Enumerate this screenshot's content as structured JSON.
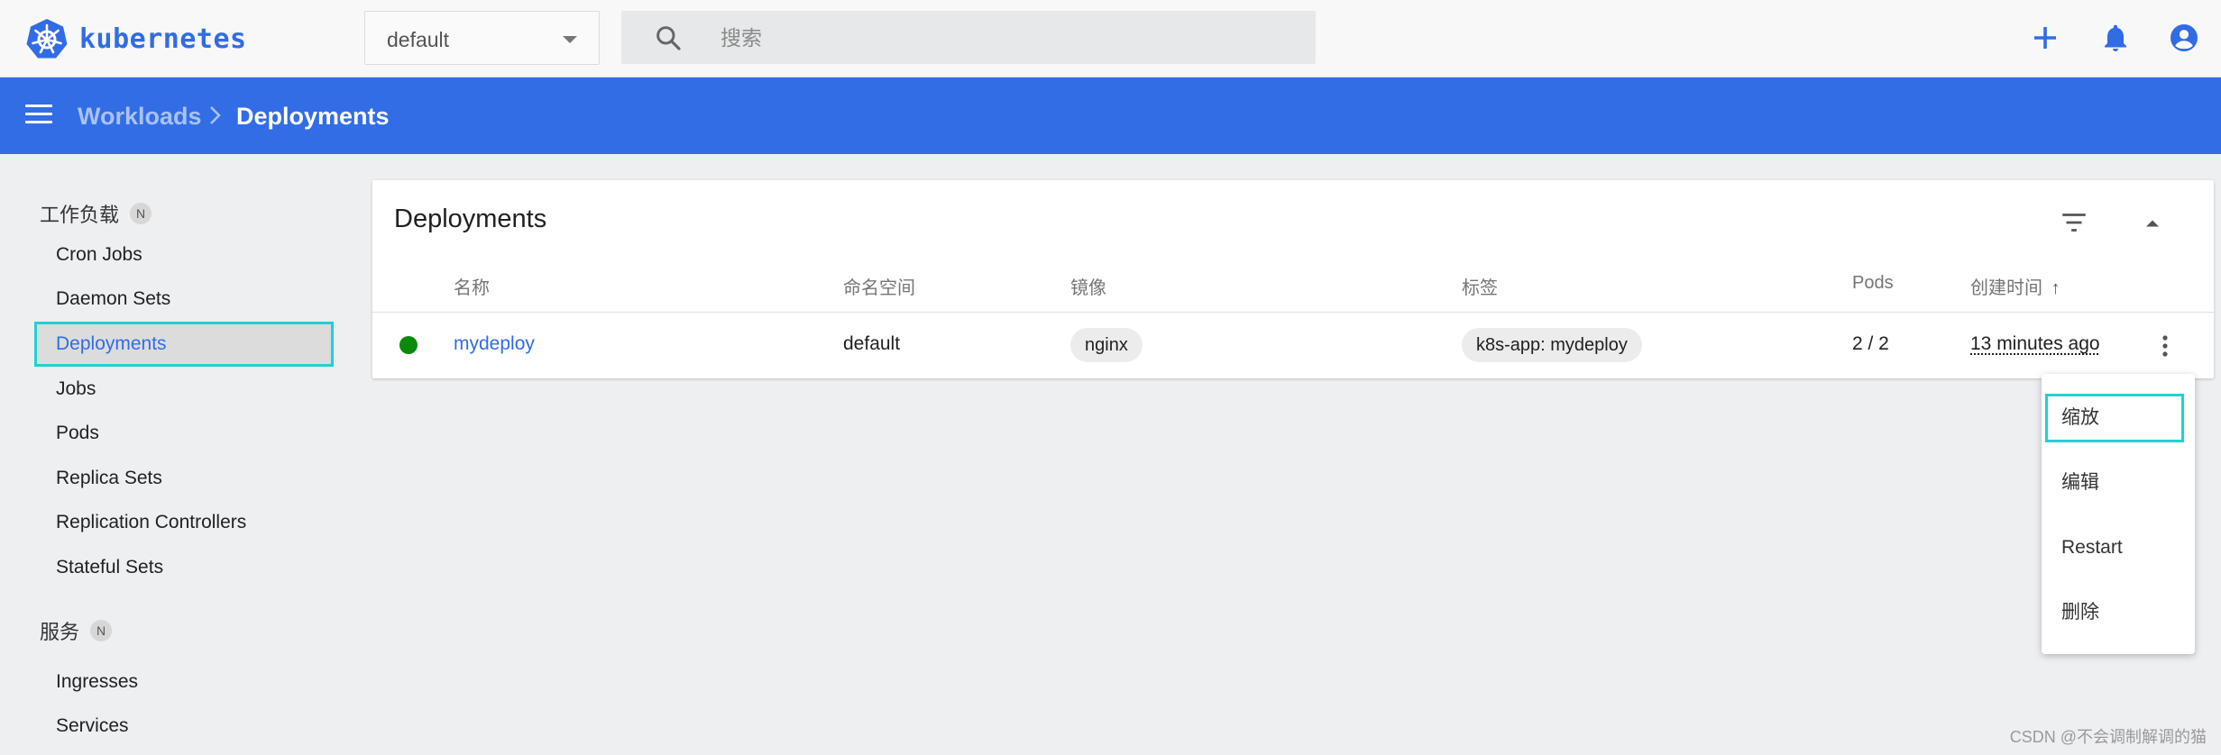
{
  "app": {
    "name": "kubernetes",
    "brand_color": "#326ce5",
    "logo_icon": "kubernetes-wheel-icon"
  },
  "topbar": {
    "namespace_value": "default",
    "search_placeholder": "搜索",
    "icons": [
      "add-icon",
      "bell-icon",
      "account-icon"
    ]
  },
  "breadcrumb": {
    "parent": "Workloads",
    "current": "Deployments"
  },
  "sidebar": {
    "sections": [
      {
        "label": "工作负载",
        "badge": "N",
        "items": [
          {
            "label": "Cron Jobs"
          },
          {
            "label": "Daemon Sets"
          },
          {
            "label": "Deployments",
            "active": true
          },
          {
            "label": "Jobs"
          },
          {
            "label": "Pods"
          },
          {
            "label": "Replica Sets"
          },
          {
            "label": "Replication Controllers"
          },
          {
            "label": "Stateful Sets"
          }
        ]
      },
      {
        "label": "服务",
        "badge": "N",
        "items": [
          {
            "label": "Ingresses"
          },
          {
            "label": "Services"
          }
        ]
      }
    ]
  },
  "card": {
    "title": "Deployments",
    "columns": [
      "名称",
      "命名空间",
      "镜像",
      "标签",
      "Pods",
      "创建时间"
    ],
    "sort_indicator": "↑",
    "rows": [
      {
        "status": "running",
        "status_color": "#0a8a0a",
        "name": "mydeploy",
        "namespace": "default",
        "image": "nginx",
        "label": "k8s-app: mydeploy",
        "pods": "2 / 2",
        "created": "13 minutes ago"
      }
    ]
  },
  "context_menu": {
    "items": [
      {
        "label": "缩放",
        "highlighted": true
      },
      {
        "label": "编辑"
      },
      {
        "label": "Restart"
      },
      {
        "label": "删除"
      }
    ]
  },
  "watermark": "CSDN @不会调制解调的猫"
}
